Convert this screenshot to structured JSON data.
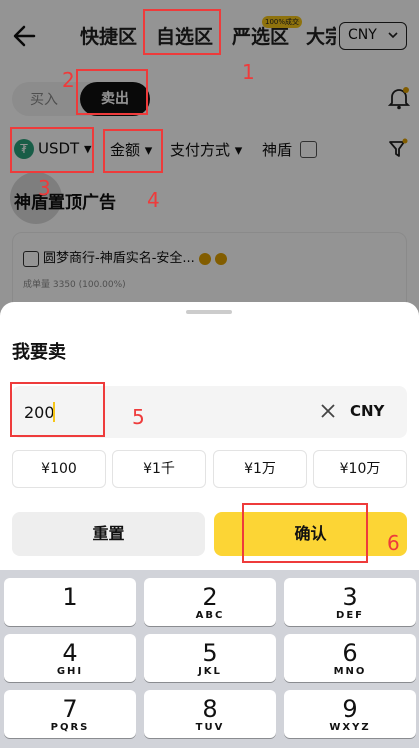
{
  "header": {
    "back_icon": "arrow-left-icon",
    "tabs": [
      {
        "label": "快捷区"
      },
      {
        "label": "自选区"
      },
      {
        "label": "严选区",
        "badge": "100%成交"
      },
      {
        "label": "大宗"
      }
    ],
    "currency": "CNY"
  },
  "trade_toggle": {
    "buy": "买入",
    "sell": "卖出"
  },
  "filters": {
    "coin": "USDT",
    "amount": "金额",
    "payment": "支付方式",
    "shield": "神盾"
  },
  "ad_section": {
    "title": "神盾置顶广告",
    "merchant_name": "圆梦商行-神盾实名-安全...",
    "merchant_stats": "成单量 3350 (100.00%)"
  },
  "sheet": {
    "title": "我要卖",
    "amount_value": "200",
    "amount_unit": "CNY",
    "presets": [
      "¥100",
      "¥1千",
      "¥1万",
      "¥10万"
    ],
    "reset_label": "重置",
    "confirm_label": "确认"
  },
  "keyboard": {
    "keys": [
      {
        "num": "1",
        "letters": ""
      },
      {
        "num": "2",
        "letters": "ABC"
      },
      {
        "num": "3",
        "letters": "DEF"
      },
      {
        "num": "4",
        "letters": "GHI"
      },
      {
        "num": "5",
        "letters": "JKL"
      },
      {
        "num": "6",
        "letters": "MNO"
      },
      {
        "num": "7",
        "letters": "PQRS"
      },
      {
        "num": "8",
        "letters": "TUV"
      },
      {
        "num": "9",
        "letters": "WXYZ"
      }
    ]
  },
  "annotations": [
    "1",
    "2",
    "3",
    "4",
    "5",
    "6"
  ],
  "colors": {
    "accent": "#fcd535",
    "annotation": "#ee3b3b",
    "usdt": "#2aa17b"
  }
}
